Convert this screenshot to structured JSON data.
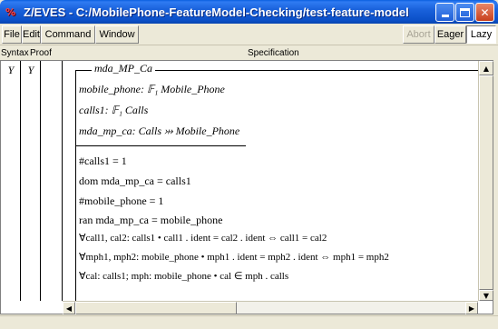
{
  "window": {
    "app_icon": "%",
    "title": "Z/EVES - C:/MobilePhone-FeatureModel-Checking/test-feature-model"
  },
  "menu": {
    "file": "File",
    "edit": "Edit",
    "command": "Command",
    "window": "Window"
  },
  "mode_buttons": {
    "abort": "Abort",
    "eager": "Eager",
    "lazy": "Lazy"
  },
  "columns": {
    "syntax": "Syntax",
    "proof": "Proof",
    "specification": "Specification"
  },
  "status": {
    "syntax": "Y",
    "proof": "Y"
  },
  "schema": {
    "name": "mda_MP_Ca",
    "declarations": [
      "mobile_phone: 𝔽₁ Mobile_Phone",
      "calls1: 𝔽₁ Calls",
      "mda_mp_ca: Calls ⤔ Mobile_Phone"
    ],
    "predicates": [
      "#calls1 = 1",
      "dom mda_mp_ca = calls1",
      "#mobile_phone = 1",
      "ran mda_mp_ca = mobile_phone",
      "∀call1, cal2: calls1 • call1 . ident = cal2 . ident ⇔ call1 = cal2",
      "∀mph1, mph2: mobile_phone • mph1 . ident = mph2 . ident ⇔ mph1 = mph2",
      "∀cal: calls1; mph: mobile_phone • cal ∈ mph . calls"
    ]
  },
  "icons": {
    "minimize": "minimize-icon",
    "maximize": "maximize-icon",
    "close": "close-icon",
    "scroll_up": "arrow-up-icon",
    "scroll_down": "arrow-down-icon",
    "scroll_left": "arrow-left-icon",
    "scroll_right": "arrow-right-icon"
  },
  "colors": {
    "title_bar": "#0b50c8",
    "close_button": "#c8401d",
    "window_face": "#ece9d8"
  }
}
